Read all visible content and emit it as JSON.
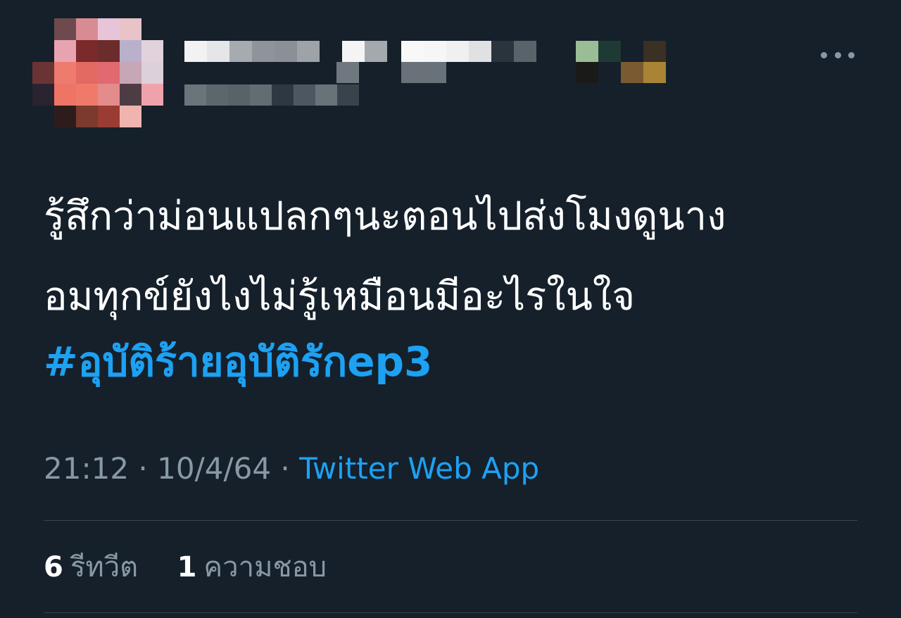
{
  "tweet": {
    "text_line_1": "รู้สึกว่าม่อนแปลกๆนะตอนไปส่งโมงดูนาง",
    "text_line_2": "อมทุกข์ยังไงไม่รู้เหมือนมีอะไรในใจ",
    "hashtag": "#อุบัติร้ายอุบัติรักep3",
    "time": "21:12",
    "date": "10/4/64",
    "separator": "·",
    "source": "Twitter Web App",
    "retweet_count": "6",
    "retweet_label": "รีทวีต",
    "like_count": "1",
    "like_label": "ความชอบ"
  },
  "icons": {
    "more": "more-horizontal-icon"
  },
  "colors": {
    "background": "#15202b",
    "accent": "#1da1f2",
    "secondary_text": "#8899a6",
    "divider": "#38444d"
  }
}
